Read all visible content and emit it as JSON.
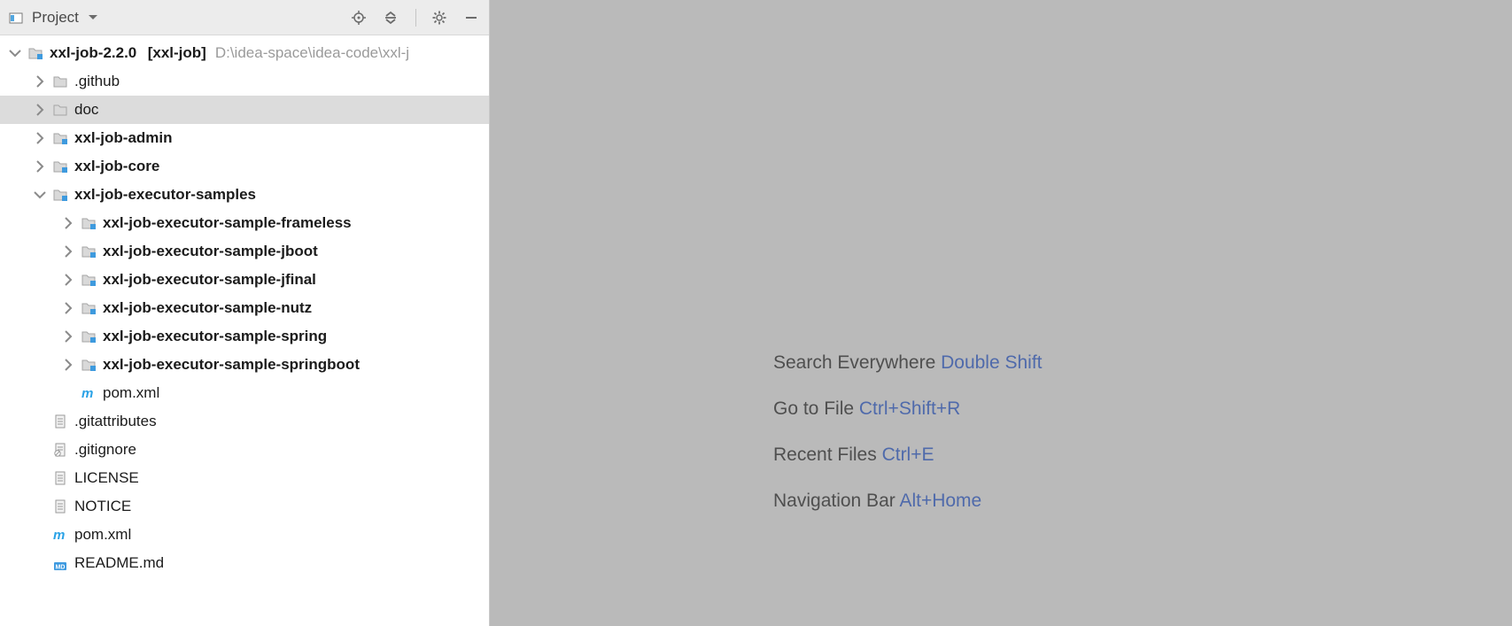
{
  "panel": {
    "title": "Project"
  },
  "tree": {
    "root": {
      "name": "xxl-job-2.2.0",
      "bracket": "[xxl-job]",
      "path": "D:\\idea-space\\idea-code\\xxl-j"
    },
    "items": [
      {
        "label": ".github"
      },
      {
        "label": "doc"
      },
      {
        "label": "xxl-job-admin"
      },
      {
        "label": "xxl-job-core"
      },
      {
        "label": "xxl-job-executor-samples"
      },
      {
        "label": "xxl-job-executor-sample-frameless"
      },
      {
        "label": "xxl-job-executor-sample-jboot"
      },
      {
        "label": "xxl-job-executor-sample-jfinal"
      },
      {
        "label": "xxl-job-executor-sample-nutz"
      },
      {
        "label": "xxl-job-executor-sample-spring"
      },
      {
        "label": "xxl-job-executor-sample-springboot"
      },
      {
        "label": "pom.xml"
      },
      {
        "label": ".gitattributes"
      },
      {
        "label": ".gitignore"
      },
      {
        "label": "LICENSE"
      },
      {
        "label": "NOTICE"
      },
      {
        "label": "pom.xml"
      },
      {
        "label": "README.md"
      }
    ]
  },
  "hints": [
    {
      "label": "Search Everywhere",
      "shortcut": "Double Shift"
    },
    {
      "label": "Go to File",
      "shortcut": "Ctrl+Shift+R"
    },
    {
      "label": "Recent Files",
      "shortcut": "Ctrl+E"
    },
    {
      "label": "Navigation Bar",
      "shortcut": "Alt+Home"
    }
  ]
}
